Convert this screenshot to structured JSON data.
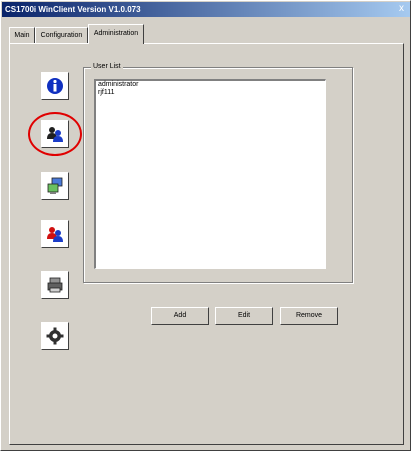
{
  "window": {
    "title": "CS1700i WinClient Version V1.0.073",
    "close_label": "x"
  },
  "tabs": [
    {
      "label": "Main",
      "active": false
    },
    {
      "label": "Configuration",
      "active": false
    },
    {
      "label": "Administration",
      "active": true
    }
  ],
  "sidebar": {
    "items": [
      {
        "icon": "info-icon"
      },
      {
        "icon": "user-management-icon",
        "highlighted": true
      },
      {
        "icon": "network-computers-icon"
      },
      {
        "icon": "users-icon"
      },
      {
        "icon": "printer-icon"
      },
      {
        "icon": "gear-icon"
      }
    ]
  },
  "user_list": {
    "legend": "User List",
    "items": [
      "administrator",
      "rjf111"
    ]
  },
  "buttons": {
    "add": "Add",
    "edit": "Edit",
    "remove": "Remove"
  },
  "colors": {
    "highlight_ring": "#e00000",
    "titlebar_start": "#0a246a",
    "titlebar_end": "#a6caf0"
  }
}
